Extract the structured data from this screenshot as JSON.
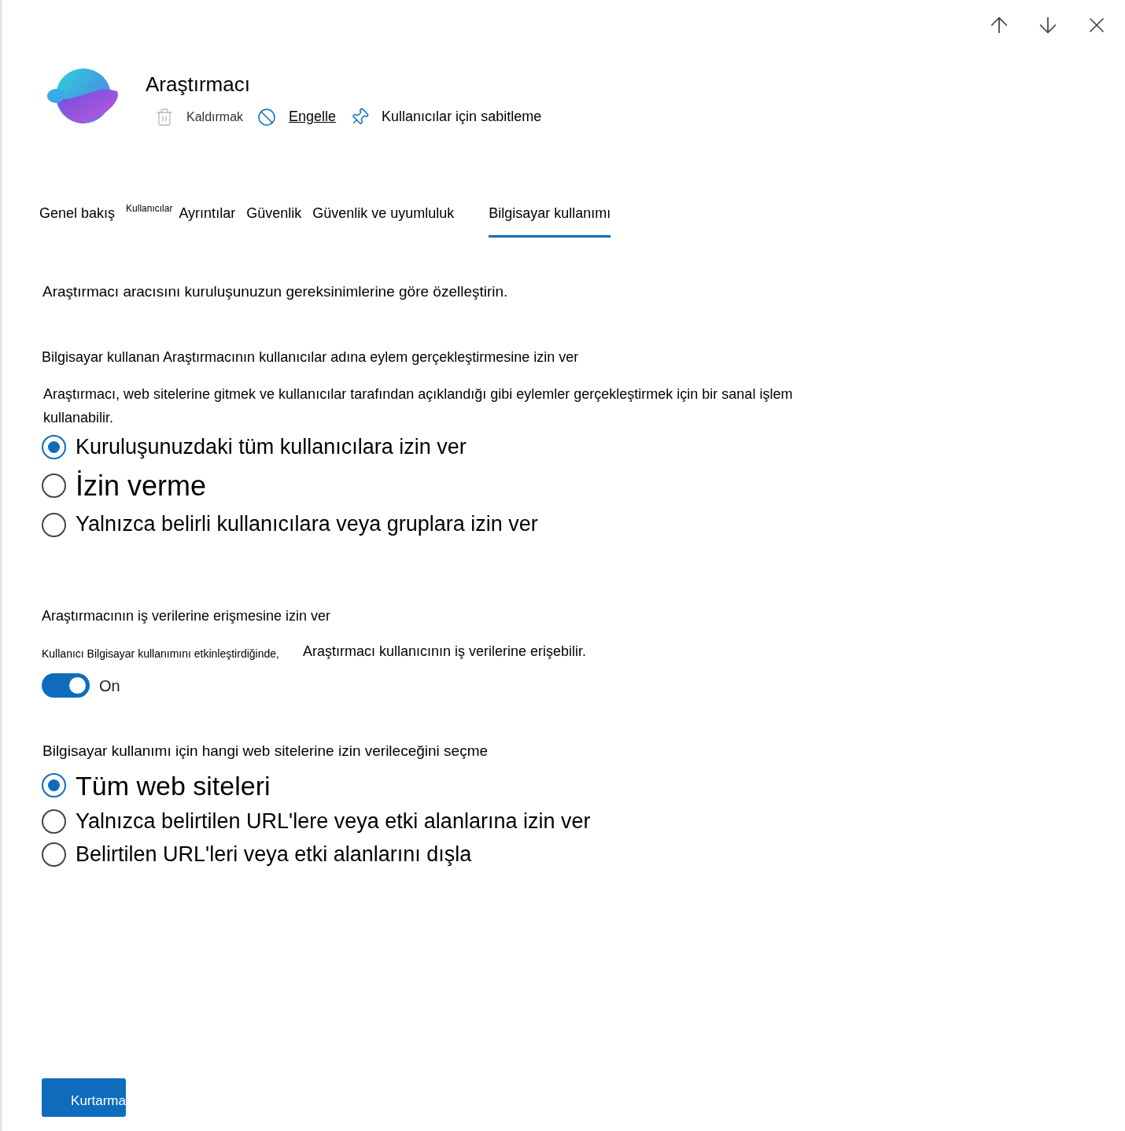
{
  "header": {
    "title": "Araştırmacı",
    "actions": [
      {
        "kind": "remove",
        "label": "Kaldırmak",
        "disabled": true
      },
      {
        "kind": "block",
        "label": "Engelle",
        "disabled": false
      },
      {
        "kind": "pin",
        "label": "Kullanıcılar için sabitleme",
        "disabled": false
      }
    ]
  },
  "tabs": [
    {
      "label": "Genel bakış",
      "selected": false
    },
    {
      "label": "Ayrıntılar",
      "prefix": "Kullanıcılar",
      "selected": false
    },
    {
      "label": "Güvenlik",
      "selected": false
    },
    {
      "label": "Güvenlik ve uyumluluk",
      "selected": false
    },
    {
      "label": "Bilgisayar kullanımı",
      "selected": true
    }
  ],
  "intro": "Araştırmacı aracısını kuruluşunuzun gereksinimlerine göre özelleştirin.",
  "actions_section": {
    "heading": "Bilgisayar kullanan Araştırmacının kullanıcılar adına eylem gerçekleştirmesine izin ver",
    "description": "Araştırmacı, web sitelerine gitmek ve kullanıcılar tarafından açıklandığı gibi eylemler gerçekleştirmek için bir sanal işlem kullanabilir.",
    "options": [
      {
        "label": "Kuruluşunuzdaki tüm kullanıcılara izin ver",
        "selected": true
      },
      {
        "label": "İzin verme",
        "selected": false
      },
      {
        "label": "Yalnızca belirli kullanıcılara veya gruplara izin ver",
        "selected": false
      }
    ]
  },
  "data_section": {
    "heading": "Araştırmacının iş verilerine erişmesine izin ver",
    "note": "Kullanıcı Bilgisayar kullanımını etkinleştirdiğinde,",
    "description": "Araştırmacı kullanıcının iş verilerine erişebilir.",
    "toggle": {
      "on": true,
      "label": "On"
    }
  },
  "sites_section": {
    "heading": "Bilgisayar kullanımı için hangi web sitelerine izin verileceğini seçme",
    "options": [
      {
        "label": "Tüm web siteleri",
        "selected": true
      },
      {
        "label": "Yalnızca belirtilen URL'lere veya etki alanlarına izin ver",
        "selected": false
      },
      {
        "label": "Belirtilen URL'leri veya etki alanlarını dışla",
        "selected": false
      }
    ]
  },
  "save_button": "Kurtarma"
}
